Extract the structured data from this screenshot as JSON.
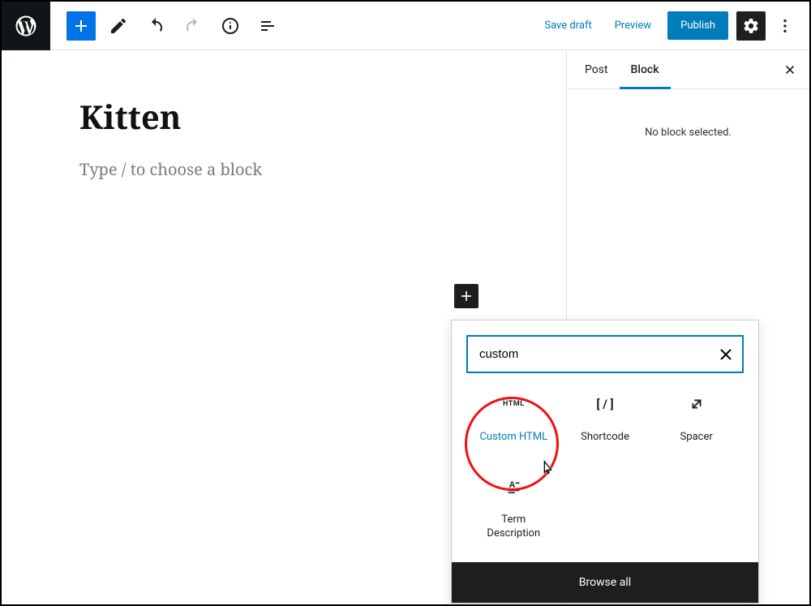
{
  "toolbar": {
    "save_draft": "Save draft",
    "preview": "Preview",
    "publish": "Publish"
  },
  "canvas": {
    "title": "Kitten",
    "placeholder": "Type / to choose a block"
  },
  "sidebar": {
    "tabs": {
      "post": "Post",
      "block": "Block"
    },
    "no_block_msg": "No block selected."
  },
  "inserter": {
    "search_value": "custom",
    "browse_all": "Browse all",
    "results": [
      {
        "label": "Custom HTML",
        "icon": "html"
      },
      {
        "label": "Shortcode",
        "icon": "bracket-slash"
      },
      {
        "label": "Spacer",
        "icon": "expand-arrows"
      },
      {
        "label": "Term Description",
        "icon": "letter-a"
      }
    ]
  }
}
